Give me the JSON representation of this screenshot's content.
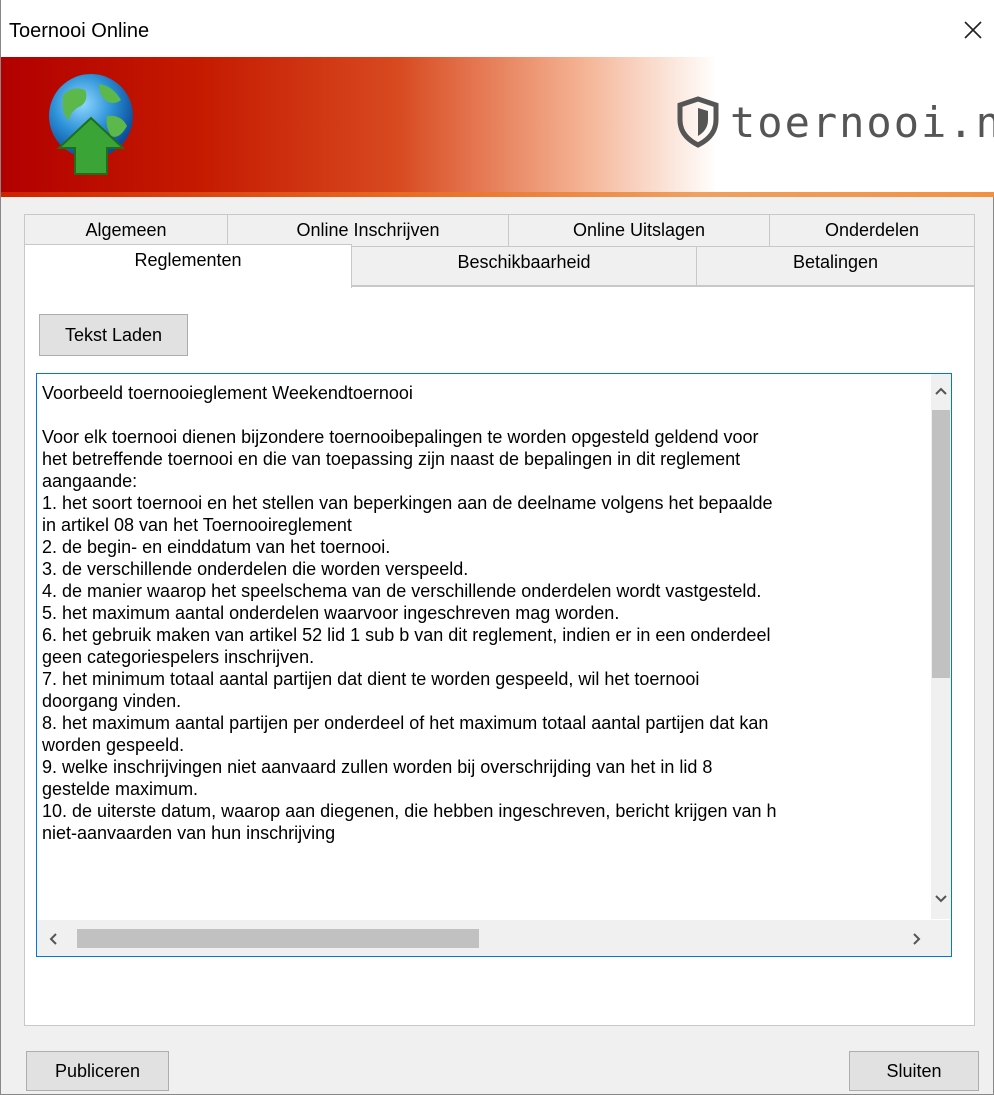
{
  "window": {
    "title": "Toernooi Online"
  },
  "banner": {
    "brand": "toernooi.nl"
  },
  "tabs_row1": [
    "Algemeen",
    "Online Inschrijven",
    "Online Uitslagen",
    "Onderdelen"
  ],
  "tabs_row2": [
    "Reglementen",
    "Beschikbaarheid",
    "Betalingen"
  ],
  "buttons": {
    "load_text": "Tekst Laden",
    "publish": "Publiceren",
    "close": "Sluiten"
  },
  "text_lines": [
    "Voorbeeld toernooieglement Weekendtoernooi",
    "",
    "Voor elk toernooi dienen bijzondere toernooibepalingen te worden opgesteld geldend voor",
    "het betreffende toernooi en die van toepassing zijn naast de bepalingen in dit reglement",
    "aangaande:",
    "1. het soort toernooi en het stellen van beperkingen aan de deelname volgens het bepaalde",
    "in artikel 08 van het Toernooireglement",
    "2. de begin- en einddatum van het toernooi.",
    "3. de verschillende onderdelen die worden verspeeld.",
    "4. de manier waarop het speelschema van de verschillende onderdelen wordt vastgesteld.",
    "5. het maximum aantal onderdelen waarvoor ingeschreven mag worden.",
    "6. het gebruik maken van artikel 52 lid 1 sub b van dit reglement, indien er in een onderdeel",
    "geen categoriespelers inschrijven.",
    "7. het minimum totaal aantal partijen dat dient te worden gespeeld, wil het toernooi",
    "doorgang vinden.",
    "8. het maximum aantal partijen per onderdeel of het maximum totaal aantal partijen dat kan",
    "worden gespeeld.",
    "9. welke inschrijvingen niet aanvaard zullen worden bij overschrijding van het in lid 8",
    "gestelde maximum.",
    "10. de uiterste datum, waarop aan diegenen, die hebben ingeschreven, bericht krijgen van h",
    "niet-aanvaarden van hun inschrijving"
  ]
}
